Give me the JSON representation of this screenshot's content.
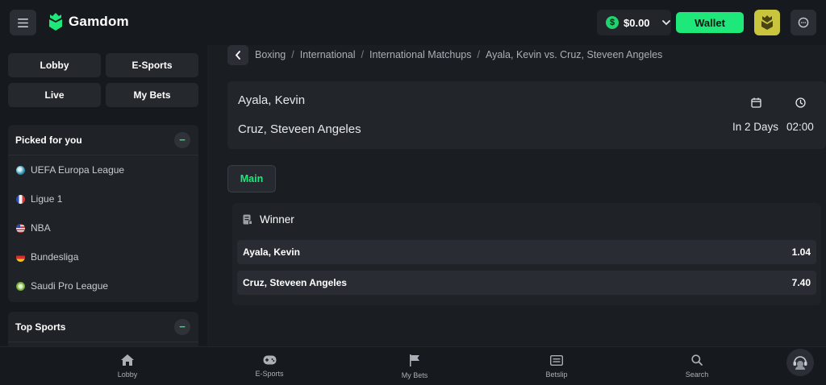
{
  "header": {
    "logo_text": "Gamdom",
    "balance": "$0.00",
    "dollar_symbol": "$",
    "wallet_label": "Wallet",
    "accent_color": "#1fe87a"
  },
  "sidebar": {
    "nav": [
      {
        "label": "Lobby"
      },
      {
        "label": "E-Sports"
      },
      {
        "label": "Live"
      },
      {
        "label": "My Bets"
      }
    ],
    "picked": {
      "title": "Picked for you",
      "toggle": "−",
      "items": [
        {
          "label": "UEFA Europa League",
          "icon": "europa-league-icon"
        },
        {
          "label": "Ligue 1",
          "icon": "france-flag-icon"
        },
        {
          "label": "NBA",
          "icon": "usa-flag-icon"
        },
        {
          "label": "Bundesliga",
          "icon": "germany-flag-icon"
        },
        {
          "label": "Saudi Pro League",
          "icon": "saudi-pro-league-icon"
        }
      ]
    },
    "top_sports": {
      "title": "Top Sports",
      "toggle": "−"
    }
  },
  "breadcrumb": [
    "Boxing",
    "International",
    "International Matchups",
    "Ayala, Kevin vs. Cruz, Steveen Angeles"
  ],
  "breadcrumb_separator": "/",
  "match": {
    "home": "Ayala, Kevin",
    "away": "Cruz, Steveen Angeles",
    "date_label": "In 2 Days",
    "time_label": "02:00"
  },
  "tabs": [
    {
      "label": "Main"
    }
  ],
  "market": {
    "title": "Winner",
    "odds": [
      {
        "name": "Ayala, Kevin",
        "value": "1.04"
      },
      {
        "name": "Cruz, Steveen Angeles",
        "value": "7.40"
      }
    ]
  },
  "bottom_nav": [
    {
      "label": "Lobby",
      "icon": "home-icon"
    },
    {
      "label": "E-Sports",
      "icon": "gamepad-icon"
    },
    {
      "label": "My Bets",
      "icon": "flag-icon"
    },
    {
      "label": "Betslip",
      "icon": "betslip-icon"
    },
    {
      "label": "Search",
      "icon": "search-icon"
    }
  ]
}
